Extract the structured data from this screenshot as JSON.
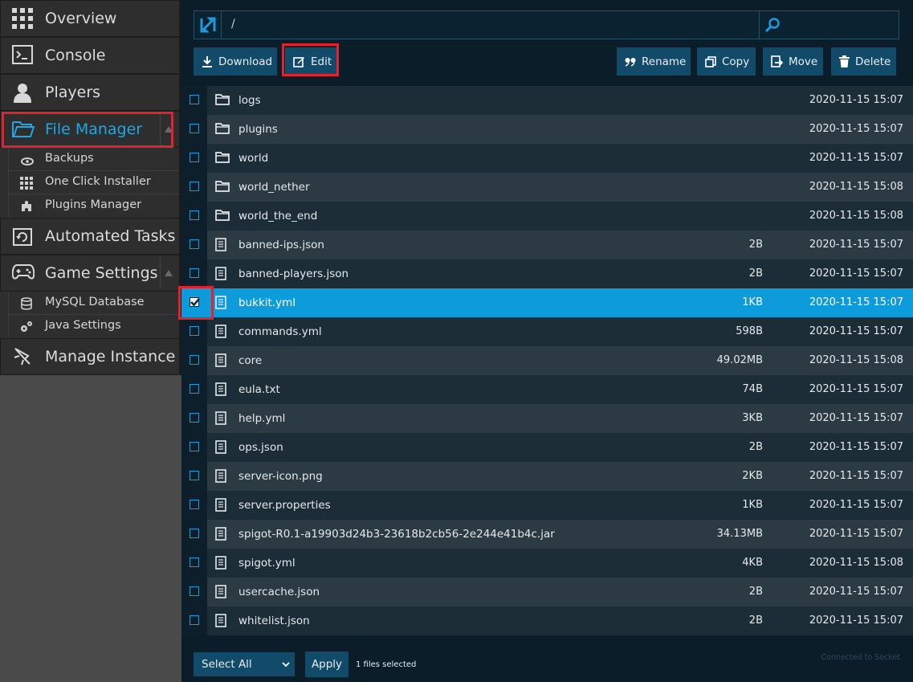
{
  "sidebar": {
    "overview": "Overview",
    "console": "Console",
    "players": "Players",
    "file_manager": "File Manager",
    "file_manager_sub": [
      "Backups",
      "One Click Installer",
      "Plugins Manager"
    ],
    "automated_tasks": "Automated Tasks",
    "game_settings": "Game Settings",
    "game_settings_sub": [
      "MySQL Database",
      "Java Settings"
    ],
    "manage_instance": "Manage Instance"
  },
  "path": {
    "value": "/"
  },
  "toolbar": {
    "download": "Download",
    "edit": "Edit",
    "rename": "Rename",
    "copy": "Copy",
    "move": "Move",
    "delete": "Delete"
  },
  "files": [
    {
      "name": "logs",
      "type": "folder",
      "size": "",
      "date": "2020-11-15 15:07",
      "selected": false
    },
    {
      "name": "plugins",
      "type": "folder",
      "size": "",
      "date": "2020-11-15 15:07",
      "selected": false
    },
    {
      "name": "world",
      "type": "folder",
      "size": "",
      "date": "2020-11-15 15:07",
      "selected": false
    },
    {
      "name": "world_nether",
      "type": "folder",
      "size": "",
      "date": "2020-11-15 15:08",
      "selected": false
    },
    {
      "name": "world_the_end",
      "type": "folder",
      "size": "",
      "date": "2020-11-15 15:08",
      "selected": false
    },
    {
      "name": "banned-ips.json",
      "type": "file",
      "size": "2B",
      "date": "2020-11-15 15:07",
      "selected": false
    },
    {
      "name": "banned-players.json",
      "type": "file",
      "size": "2B",
      "date": "2020-11-15 15:07",
      "selected": false
    },
    {
      "name": "bukkit.yml",
      "type": "file",
      "size": "1KB",
      "date": "2020-11-15 15:07",
      "selected": true
    },
    {
      "name": "commands.yml",
      "type": "file",
      "size": "598B",
      "date": "2020-11-15 15:07",
      "selected": false
    },
    {
      "name": "core",
      "type": "file",
      "size": "49.02MB",
      "date": "2020-11-15 15:08",
      "selected": false
    },
    {
      "name": "eula.txt",
      "type": "file",
      "size": "74B",
      "date": "2020-11-15 15:07",
      "selected": false
    },
    {
      "name": "help.yml",
      "type": "file",
      "size": "3KB",
      "date": "2020-11-15 15:07",
      "selected": false
    },
    {
      "name": "ops.json",
      "type": "file",
      "size": "2B",
      "date": "2020-11-15 15:07",
      "selected": false
    },
    {
      "name": "server-icon.png",
      "type": "file",
      "size": "2KB",
      "date": "2020-11-15 15:07",
      "selected": false
    },
    {
      "name": "server.properties",
      "type": "file",
      "size": "1KB",
      "date": "2020-11-15 15:07",
      "selected": false
    },
    {
      "name": "spigot-R0.1-a19903d24b3-23618b2cb56-2e244e41b4c.jar",
      "type": "file",
      "size": "34.13MB",
      "date": "2020-11-15 15:07",
      "selected": false
    },
    {
      "name": "spigot.yml",
      "type": "file",
      "size": "4KB",
      "date": "2020-11-15 15:08",
      "selected": false
    },
    {
      "name": "usercache.json",
      "type": "file",
      "size": "2B",
      "date": "2020-11-15 15:07",
      "selected": false
    },
    {
      "name": "whitelist.json",
      "type": "file",
      "size": "2B",
      "date": "2020-11-15 15:07",
      "selected": false
    }
  ],
  "footer": {
    "select_all": "Select All",
    "apply": "Apply",
    "selected_count": "1 files selected",
    "socket_status": "Connected to Socket"
  },
  "colors": {
    "accent": "#1ea7e4",
    "selected_row": "#0e9bdc",
    "button": "#124a6a",
    "highlight": "#e0232c"
  }
}
